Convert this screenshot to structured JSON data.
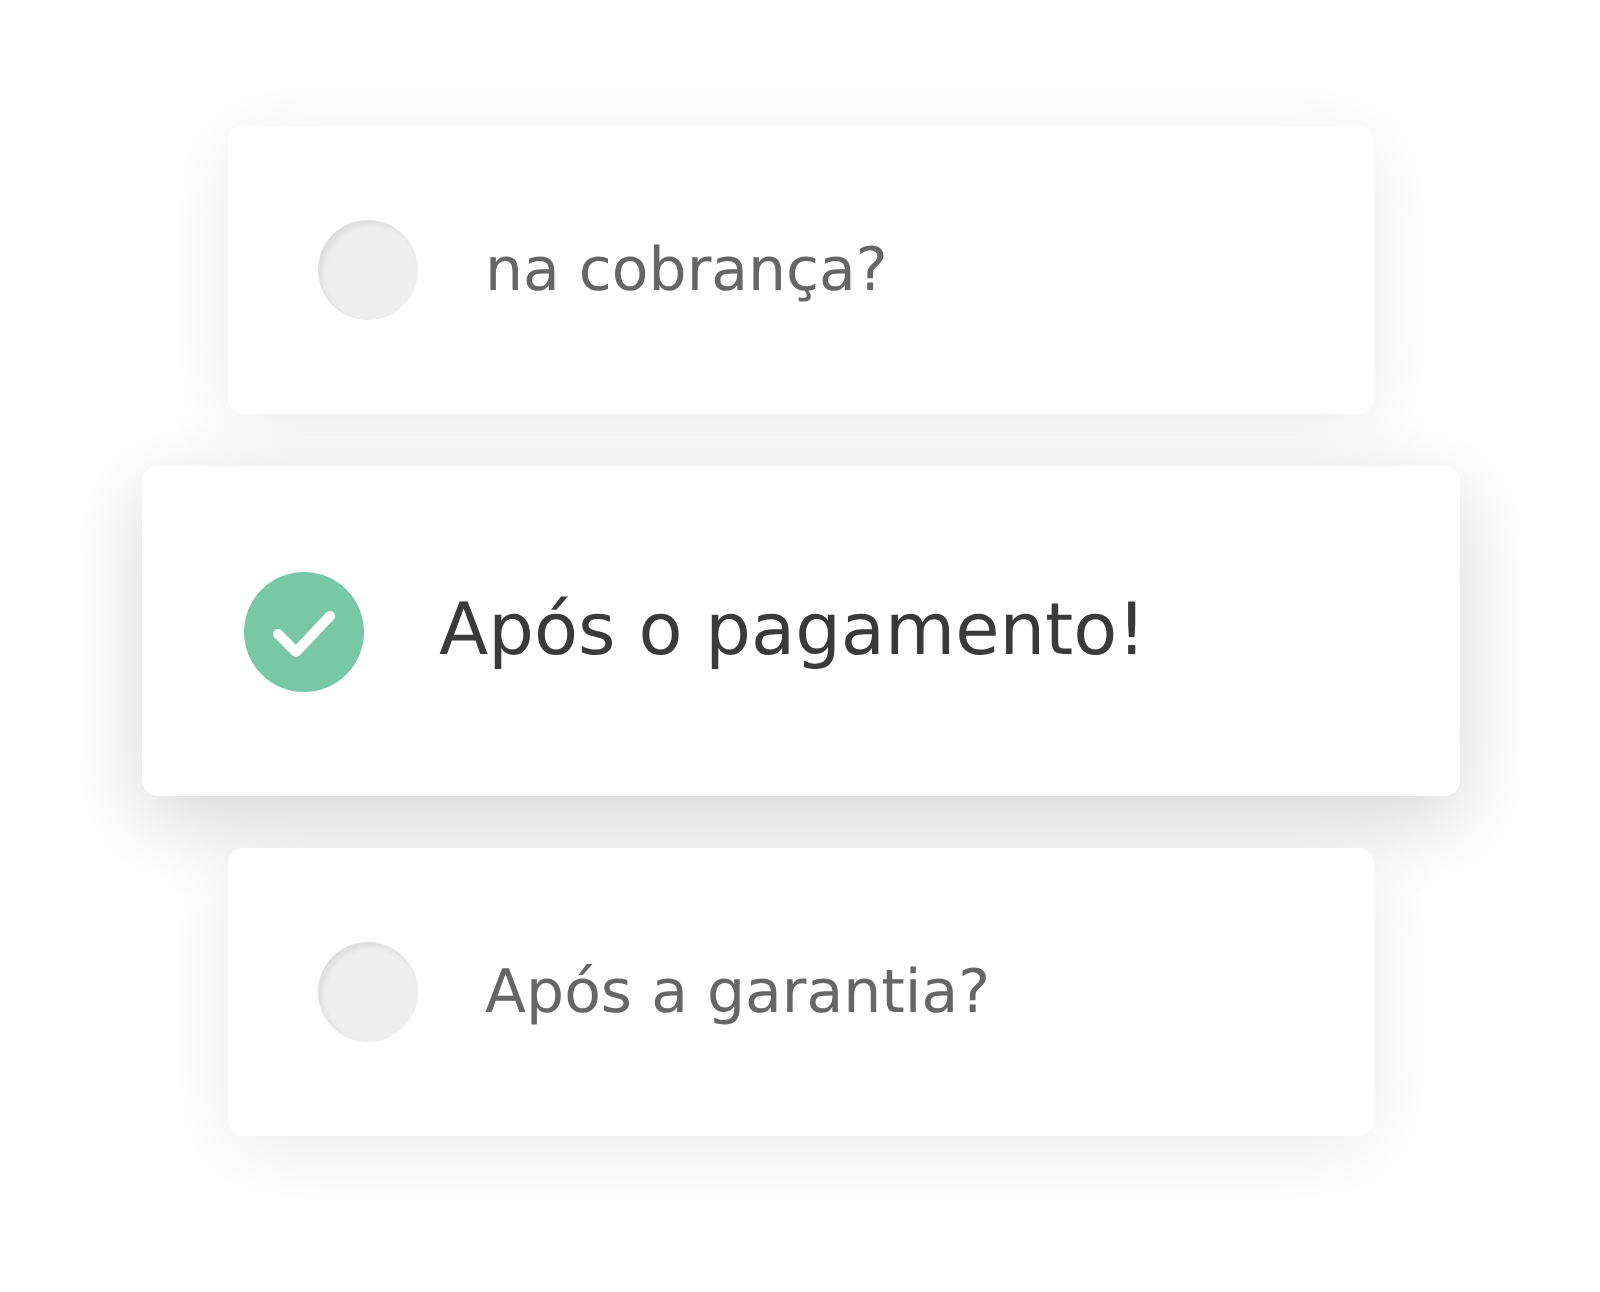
{
  "options": [
    {
      "label": "na cobrança?",
      "selected": false
    },
    {
      "label": "Após o pagamento!",
      "selected": true
    },
    {
      "label": "Após a garantia?",
      "selected": false
    }
  ]
}
